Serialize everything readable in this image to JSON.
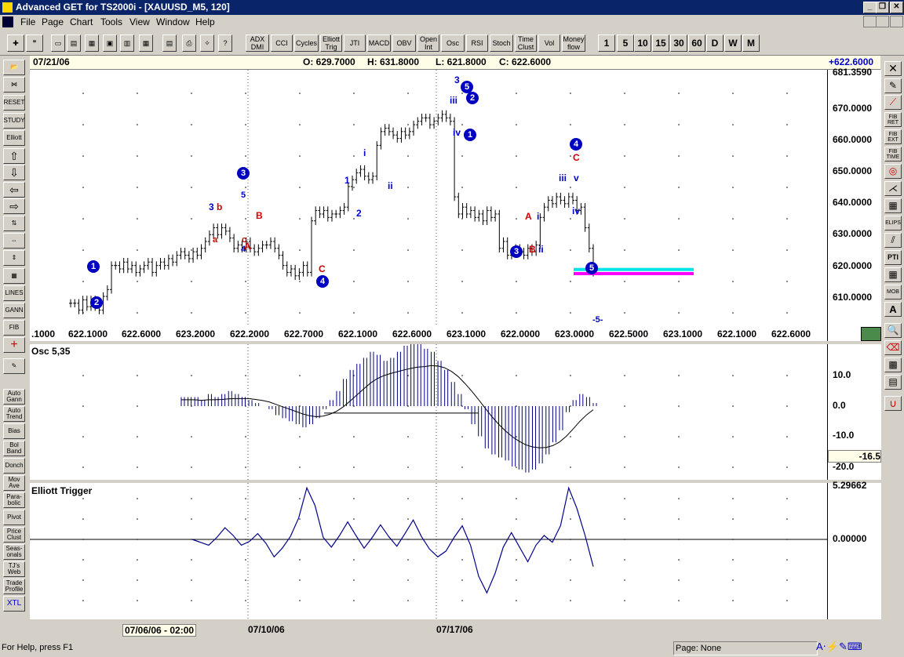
{
  "window": {
    "title": "Advanced GET for TS2000i - [XAUUSD_M5, 120]",
    "controls": [
      "_",
      "❐",
      "✕"
    ]
  },
  "menu": [
    "File",
    "Page",
    "Chart",
    "Tools",
    "View",
    "Window",
    "Help"
  ],
  "toolbar": {
    "indicators": [
      "ADX DMI",
      "CCI",
      "Cycles",
      "Elliott Trig",
      "JTI",
      "MACD",
      "OBV",
      "Open Int",
      "Osc",
      "RSI",
      "Stoch",
      "Time Clust",
      "Vol",
      "Money flow"
    ],
    "timeframes": [
      "1",
      "5",
      "10",
      "15",
      "30",
      "60",
      "D",
      "W",
      "M"
    ]
  },
  "left_tools": [
    "RESET",
    "STUDY",
    "Elliott",
    "LINES",
    "GANN",
    "FIB"
  ],
  "left_studies": [
    "Auto Gann",
    "Auto Trend",
    "Bias",
    "Bol Band",
    "Donch",
    "Mov Ave",
    "Para-bolic",
    "Pivot",
    "Price Clust",
    "Seas-onals",
    "TJ's Web",
    "Trade Profile",
    "XTL"
  ],
  "right_tools": [
    "FIB RET",
    "FIB EXT",
    "FIB TIME",
    "ELIPS",
    "PTI",
    "MOB",
    "A"
  ],
  "chart_header": {
    "date": "07/21/06",
    "open": "O: 629.7000",
    "high": "H: 631.8000",
    "low": "L: 621.8000",
    "close": "C: 622.6000",
    "change": "+622.6000"
  },
  "price_axis": [
    "681.3590",
    "670.0000",
    "660.0000",
    "650.0000",
    "640.0000",
    "630.0000",
    "620.0000",
    "610.0000"
  ],
  "bottom_labels": [
    ".1000",
    "622.1000",
    "622.6000",
    "623.2000",
    "622.2000",
    "622.7000",
    "622.1000",
    "622.6000",
    "623.1000",
    "622.0000",
    "623.0000",
    "622.5000",
    "623.1000",
    "622.1000",
    "622.6000"
  ],
  "osc": {
    "title": "Osc 5,35",
    "axis": [
      "10.0",
      "0.0",
      "-10.0",
      "-20.0"
    ],
    "current": "-16.5"
  },
  "trigger": {
    "title": "Elliott Trigger",
    "axis": [
      "5.29662",
      "0.00000"
    ]
  },
  "date_axis": [
    "07/06/06 - 02:00",
    "07/10/06",
    "07/17/06"
  ],
  "wave_labels": {
    "n1a": "1",
    "n2a": "2",
    "n3a": "3",
    "n4a": "4",
    "n5a": "5",
    "n3b": "3",
    "n4b": "4",
    "n5b": "5",
    "n2b": "2",
    "n1b": "1",
    "n5c": "5",
    "n3c": "3",
    "a1": "a",
    "b1": "b",
    "c1": "c",
    "A1": "A",
    "B1": "B",
    "C1": "C",
    "A2": "A",
    "B2": "B",
    "C2": "C",
    "i1": "i",
    "ii1": "ii",
    "iii1": "iii",
    "iv1": "iv",
    "v1": "v",
    "i2": "i",
    "ii2": "ii",
    "iv2": "iv",
    "one": "1",
    "two": "2",
    "five": "5",
    "four": "4",
    "three": "3",
    "five2": "-5-"
  },
  "status": {
    "help": "For Help, press F1",
    "page": "Page: None"
  },
  "chart_data": {
    "type": "bar",
    "x_dates": [
      "07/06/06 - 02:00",
      "07/10/06",
      "07/17/06"
    ],
    "ylim": [
      603,
      682
    ],
    "ohlc_close_trace": [
      614,
      614,
      612,
      615,
      613,
      615,
      613,
      612,
      616,
      618,
      625,
      625,
      624,
      626,
      624,
      625,
      623,
      624,
      625,
      626,
      623,
      625,
      626,
      625,
      627,
      626,
      628,
      629,
      628,
      627,
      629,
      628,
      630,
      632,
      634,
      636,
      634,
      636,
      635,
      633,
      630,
      631,
      630,
      632,
      630,
      629,
      630,
      631,
      631,
      632,
      630,
      628,
      625,
      623,
      624,
      622,
      623,
      625,
      623,
      638,
      641,
      640,
      641,
      639,
      640,
      640,
      641,
      642,
      648,
      650,
      652,
      653,
      651,
      650,
      651,
      660,
      664,
      665,
      664,
      663,
      662,
      664,
      663,
      664,
      666,
      667,
      668,
      668,
      666,
      667,
      668,
      669,
      668,
      667,
      645,
      640,
      642,
      640,
      641,
      639,
      640,
      638,
      641,
      639,
      640,
      630,
      632,
      628,
      629,
      630,
      629,
      628,
      630,
      629,
      631,
      639,
      642,
      644,
      643,
      645,
      644,
      643,
      645,
      644,
      641,
      642,
      636,
      630,
      623
    ],
    "osc_values": [
      3,
      3,
      3,
      2,
      4,
      3,
      4,
      5,
      4,
      3,
      2,
      1,
      0,
      -1,
      -3,
      -4,
      -5,
      -6,
      -7,
      -6,
      -4,
      -1,
      2,
      5,
      9,
      12,
      14,
      16,
      18,
      17,
      15,
      16,
      18,
      20,
      21,
      22,
      19,
      18,
      15,
      12,
      8,
      4,
      -1,
      -6,
      -10,
      -14,
      -16,
      -17,
      -18,
      -20,
      -21,
      -22,
      -21,
      -19,
      -16,
      -12,
      -8,
      -2,
      2,
      4,
      3,
      1
    ],
    "trigger_values": [
      0,
      -0.3,
      -0.6,
      0.2,
      1.2,
      0.4,
      -0.6,
      -0.2,
      0.6,
      -0.4,
      -1.8,
      -0.9,
      0.3,
      2.2,
      5.3,
      3.5,
      0.2,
      -0.8,
      0.4,
      1.8,
      0.4,
      -0.9,
      0.2,
      1.5,
      0.3,
      -0.7,
      0.6,
      2.0,
      0.3,
      -1.0,
      -1.8,
      -1.2,
      0.2,
      1.4,
      -0.6,
      -3.8,
      -5.5,
      -3.5,
      -0.8,
      0.7,
      -0.8,
      -2.3,
      -0.6,
      0.4,
      -0.3,
      1.4,
      5.3,
      3.2,
      0.4,
      -2.8
    ]
  }
}
